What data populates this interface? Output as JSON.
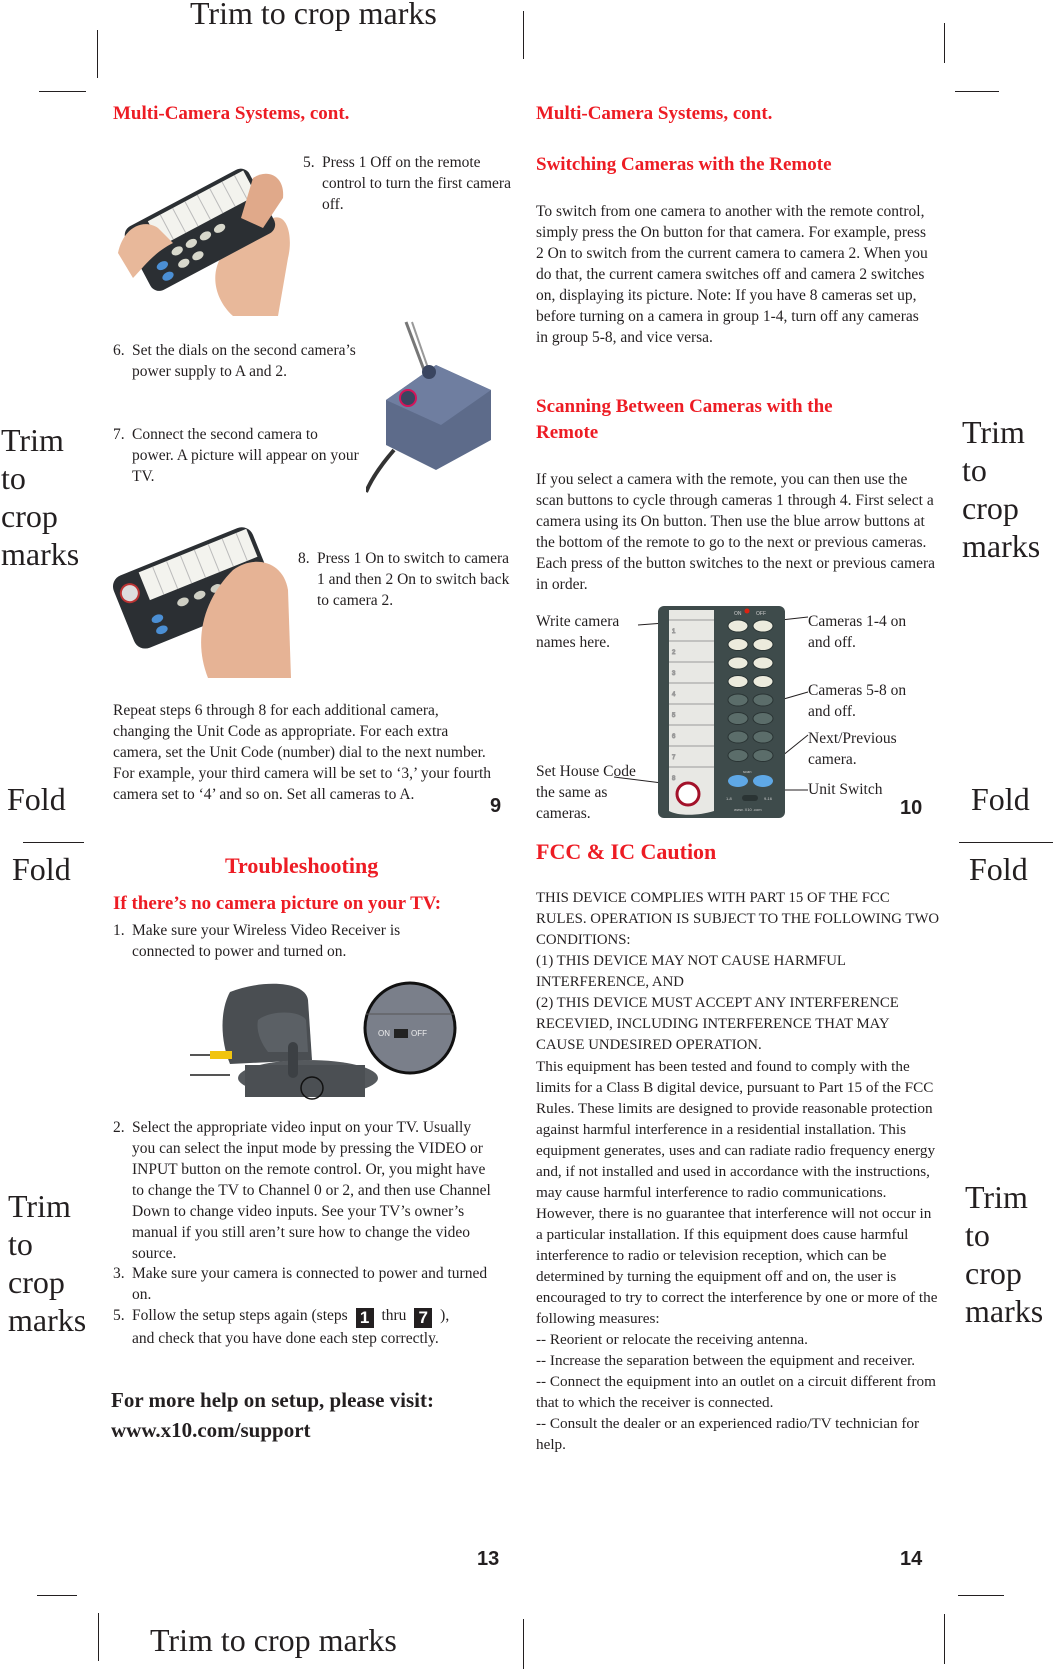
{
  "crop_marks": {
    "top_label": "Trim to crop marks",
    "bottom_label": "Trim to crop marks",
    "side_label_lines": [
      "Trim",
      "to",
      "crop",
      "marks"
    ],
    "fold_label": "Fold"
  },
  "page_9": {
    "number": "9",
    "title": "Multi-Camera Systems, cont.",
    "steps": [
      {
        "num": "5.",
        "text": "Press 1 Off on the remote control to turn the first camera off."
      },
      {
        "num": "6.",
        "text": "Set the dials on the second camera’s power supply to A and 2."
      },
      {
        "num": "7.",
        "text": "Connect the second camera to power. A picture will appear on your TV."
      },
      {
        "num": "8.",
        "text": "Press 1 On to switch to camera 1 and then 2 On to switch back to camera 2."
      }
    ],
    "repeat_paragraph": "Repeat steps 6 through 8 for each additional camera, changing the Unit Code as appropriate. For each extra camera, set the Unit Code (number) dial to the next number. For example, your third camera will be set to ‘3,’ your fourth camera set to ‘4’ and so on. Set all cameras to A."
  },
  "page_10": {
    "number": "10",
    "title": "Multi-Camera Systems, cont.",
    "switching_heading": "Switching Cameras with the Remote",
    "switching_paragraph": "To switch from one camera to another with the remote control, simply press the On button for that camera. For example, press 2 On to switch from the current camera to camera 2. When you do that, the current camera switches off and camera 2 switches on, displaying its picture. Note: If you have 8 cameras set up, before turning on a camera in group 1-4, turn off any cameras in group 5-8, and vice versa.",
    "scanning_heading": "Scanning Between Cameras with the Remote",
    "scanning_paragraph": "If you select a camera with the remote, you can then use the scan buttons to cycle through cameras 1 through 4. First select a camera using its On button. Then use the blue arrow buttons at the bottom of the remote to go to the next or previous cameras. Each press of the button switches to the next or previous camera in order.",
    "callouts": {
      "write_names": "Write camera names here.",
      "set_house_code": "Set House Code the same as cameras.",
      "cameras_1_4": "Cameras 1-4 on and off.",
      "cameras_5_8": "Cameras 5-8 on and off.",
      "next_previous": "Next/Previous camera.",
      "unit_switch": "Unit Switch"
    },
    "remote": {
      "on_label": "ON",
      "off_label": "OFF",
      "slot_numbers": [
        "1",
        "2",
        "3",
        "4",
        "5",
        "6",
        "7",
        "8"
      ],
      "scan_label": "scan",
      "unit_left": "1-8",
      "unit_right": "9-16",
      "brand": "www. X10 .com"
    }
  },
  "page_13": {
    "number": "13",
    "title": "Troubleshooting",
    "subheading": "If there’s no camera picture on your TV:",
    "steps": [
      {
        "num": "1.",
        "text": "Make sure your Wireless Video Receiver is connected to power and turned on."
      },
      {
        "num": "2.",
        "text": "Select the appropriate video input on your TV. Usually you can select the input mode by pressing the VIDEO or INPUT button on the remote control. Or, you might have to change the TV to Channel 0 or 2, and then use Channel Down to change video inputs. See your TV’s owner’s manual if you still aren’t sure how to change the video source."
      },
      {
        "num": "3.",
        "text": "Make sure your camera is connected to power and turned on."
      }
    ],
    "step5": {
      "num": "5.",
      "before": "Follow the setup steps again (steps",
      "box1": "1",
      "middle": "thru",
      "box2": "7",
      "after": "),",
      "line2": "and check that you have done each step correctly."
    },
    "receiver_switch": {
      "on": "ON",
      "off": "OFF"
    },
    "help_line1": "For more help on setup, please visit:",
    "help_line2": "www.x10.com/support"
  },
  "page_14": {
    "number": "14",
    "title": "FCC & IC Caution",
    "compliance_lines": [
      "THIS DEVICE COMPLIES WITH PART 15 OF THE FCC RULES. OPERATION IS SUBJECT TO THE FOLLOWING TWO CONDITIONS:",
      "(1) THIS DEVICE MAY NOT CAUSE HARMFUL INTERFERENCE, AND",
      "(2) THIS DEVICE MUST ACCEPT ANY INTERFERENCE RECEVIED, INCLUDING INTERFERENCE THAT MAY CAUSE UNDESIRED OPERATION."
    ],
    "body_paragraph": "This equipment has been tested and found to comply with the limits for a Class B digital device, pursuant to Part 15 of the FCC Rules. These limits are designed to provide reasonable protection against harmful interference in a residential installation. This equipment generates, uses and can radiate radio frequency energy and, if not installed and used in accordance with the instructions, may cause harmful interference to radio communications. However, there is no guarantee that interference will not occur in a particular installation. If this equipment does cause harmful interference to radio or television reception, which can be determined by turning the equipment off and on, the user is encouraged to try to correct the interference by one or more of the following measures:",
    "measures": [
      "-- Reorient or relocate the receiving antenna.",
      "-- Increase the separation between the equipment and receiver.",
      "-- Connect the equipment into an outlet on a circuit different from that to which the receiver is connected.",
      "-- Consult the dealer or an experienced radio/TV technician for help."
    ]
  },
  "colors": {
    "heading_red": "#ed1c24",
    "text": "#231f20"
  }
}
